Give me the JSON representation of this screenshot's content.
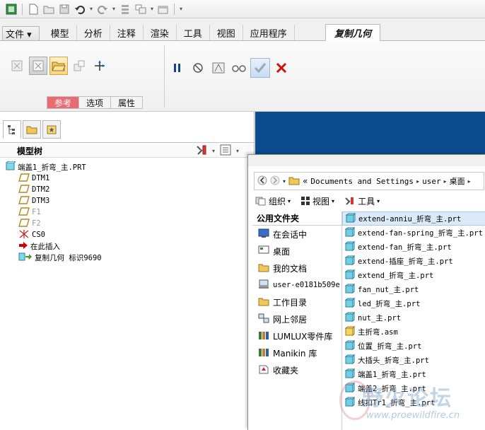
{
  "ribbon": {
    "tabs": [
      {
        "label": "文件 ▾",
        "kind": "file"
      },
      {
        "label": "模型"
      },
      {
        "label": "分析"
      },
      {
        "label": "注释"
      },
      {
        "label": "渲染"
      },
      {
        "label": "工具"
      },
      {
        "label": "视图"
      },
      {
        "label": "应用程序"
      }
    ],
    "active_tab": "复制几何",
    "subtabs": [
      "参考",
      "选项",
      "属性"
    ]
  },
  "model_tree": {
    "title": "模型树",
    "items": [
      {
        "label": "端盖1_折弯_主.PRT",
        "icon": "part-icon",
        "indent": 0,
        "dim": false
      },
      {
        "label": "DTM1",
        "icon": "datum-plane-icon",
        "indent": 1,
        "dim": false
      },
      {
        "label": "DTM2",
        "icon": "datum-plane-icon",
        "indent": 1,
        "dim": false
      },
      {
        "label": "DTM3",
        "icon": "datum-plane-icon",
        "indent": 1,
        "dim": false
      },
      {
        "label": "F1",
        "icon": "datum-plane-icon",
        "indent": 1,
        "dim": true
      },
      {
        "label": "F2",
        "icon": "datum-plane-icon",
        "indent": 1,
        "dim": true
      },
      {
        "label": "CS0",
        "icon": "coordinate-system-icon",
        "indent": 1,
        "dim": false
      },
      {
        "label": "在此插入",
        "icon": "insert-here-arrow-icon",
        "indent": 1,
        "dim": false
      },
      {
        "label": "复制几何 标识9690",
        "icon": "copy-geometry-icon",
        "indent": 1,
        "dim": false
      }
    ]
  },
  "dialog": {
    "path": [
      "Documents and Settings",
      "user",
      "桌面"
    ],
    "toolbar": [
      "组织",
      "视图",
      "工具"
    ],
    "places_header": "公用文件夹",
    "places": [
      {
        "label": "在会话中",
        "icon": "session-icon",
        "mono": false
      },
      {
        "label": "桌面",
        "icon": "desktop-icon",
        "mono": false
      },
      {
        "label": "我的文档",
        "icon": "folder-icon",
        "mono": false
      },
      {
        "label": "user-e0181b509e",
        "icon": "computer-icon",
        "mono": true
      },
      {
        "label": "工作目录",
        "icon": "folder-icon",
        "mono": false
      },
      {
        "label": "网上邻居",
        "icon": "network-icon",
        "mono": false
      },
      {
        "label": "LUMLUX零件库",
        "icon": "library-icon",
        "mono": false
      },
      {
        "label": "Manikin 库",
        "icon": "library-icon",
        "mono": false
      },
      {
        "label": "收藏夹",
        "icon": "favorites-icon",
        "mono": false
      }
    ],
    "files": [
      {
        "label": "extend-anniu_折弯_主.prt",
        "type": "prt",
        "selected": true
      },
      {
        "label": "extend-fan-spring_折弯_主.prt",
        "type": "prt",
        "selected": false
      },
      {
        "label": "extend-fan_折弯_主.prt",
        "type": "prt",
        "selected": false
      },
      {
        "label": "extend-插座_折弯_主.prt",
        "type": "prt",
        "selected": false
      },
      {
        "label": "extend_折弯_主.prt",
        "type": "prt",
        "selected": false
      },
      {
        "label": "fan_nut_主.prt",
        "type": "prt",
        "selected": false
      },
      {
        "label": "led_折弯_主.prt",
        "type": "prt",
        "selected": false
      },
      {
        "label": "nut_主.prt",
        "type": "prt",
        "selected": false
      },
      {
        "label": "主折弯.asm",
        "type": "asm",
        "selected": false
      },
      {
        "label": "位置_折弯_主.prt",
        "type": "prt",
        "selected": false
      },
      {
        "label": "大插头_折弯_主.prt",
        "type": "prt",
        "selected": false
      },
      {
        "label": "端盖1_折弯_主.prt",
        "type": "prt",
        "selected": false
      },
      {
        "label": "端盖2_折弯_主.prt",
        "type": "prt",
        "selected": false
      },
      {
        "label": "线扣Tr1_折弯_主.prt",
        "type": "prt",
        "selected": false
      }
    ]
  },
  "watermark": {
    "text": "野火论坛",
    "url": "www.proewildfire.cn"
  },
  "colors": {
    "graphics_bg": "#0b4b8e",
    "reference_tab": "#e96a73",
    "cancel_red": "#d01010"
  }
}
